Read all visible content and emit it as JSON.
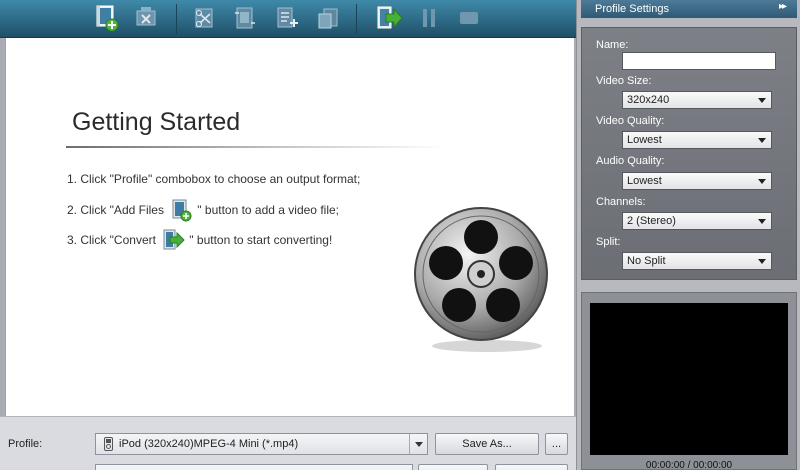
{
  "toolbar": {
    "buttons": [
      {
        "icon": "add-file-icon"
      },
      {
        "icon": "remove-icon"
      },
      {
        "icon": "trim-icon"
      },
      {
        "icon": "crop-icon"
      },
      {
        "icon": "merge-icon"
      },
      {
        "icon": "snapshot-icon"
      },
      {
        "icon": "convert-icon"
      },
      {
        "icon": "pause-icon"
      },
      {
        "icon": "stop-icon"
      }
    ]
  },
  "getting_started": {
    "title": "Getting Started",
    "step1": "1. Click \"Profile\" combobox to choose an output format;",
    "step2_before": "2. Click \"Add Files ",
    "step2_after": "\" button to add a video file;",
    "step3_before": "3. Click \"Convert ",
    "step3_after": "\" button to start converting!"
  },
  "bottom": {
    "profile_label": "Profile:",
    "profile_value": "iPod (320x240)MPEG-4 Mini (*.mp4)",
    "save_as_label": "Save As...",
    "more_label": "..."
  },
  "panel": {
    "header": "Profile Settings",
    "header_icon": "▸▸",
    "name_label": "Name:",
    "name_value": "",
    "video_size_label": "Video Size:",
    "video_size_value": "320x240",
    "video_quality_label": "Video Quality:",
    "video_quality_value": "Lowest",
    "audio_quality_label": "Audio Quality:",
    "audio_quality_value": "Lowest",
    "channels_label": "Channels:",
    "channels_value": "2 (Stereo)",
    "split_label": "Split:",
    "split_value": "No Split"
  },
  "preview": {
    "time": "00:00:00 / 00:00:00"
  },
  "colors": {
    "toolbar": "#2c6783",
    "panel_header": "#3a6685",
    "settings_bg": "#74777d",
    "preview_screen": "#000000"
  }
}
